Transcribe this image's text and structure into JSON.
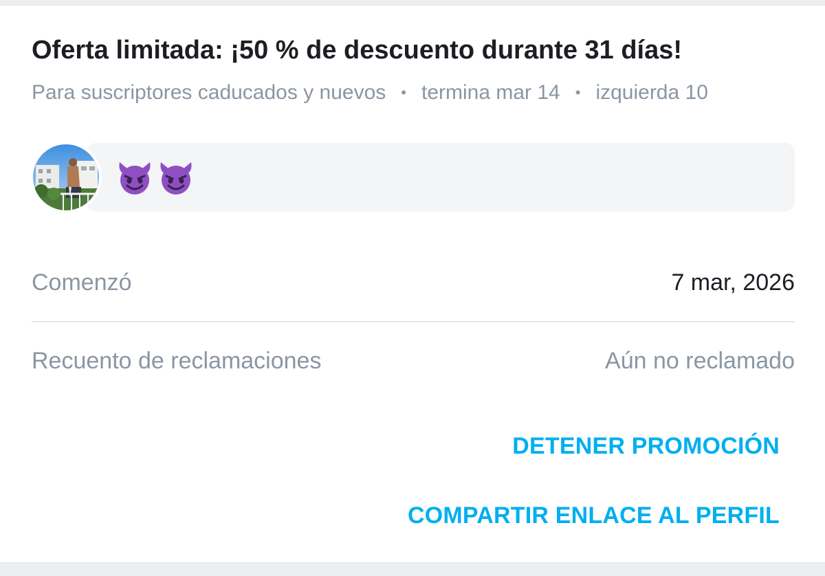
{
  "promo": {
    "title": "Oferta limitada: ¡50 % de descuento durante 31 días!",
    "audience": "Para suscriptores caducados y nuevos",
    "ends": "termina mar 14",
    "remaining": "izquierda 10",
    "separator": "•",
    "discount_percent": 50,
    "duration_days": 31
  },
  "message": {
    "emojis": [
      "devil-emoji",
      "devil-emoji"
    ],
    "text": "😈😈"
  },
  "details": {
    "started_label": "Comenzó",
    "started_value": "7 mar, 2026",
    "claims_label": "Recuento de reclamaciones",
    "claims_value": "Aún no reclamado"
  },
  "actions": {
    "stop_label": "DETENER PROMOCIÓN",
    "share_label": "COMPARTIR ENLACE AL PERFIL"
  },
  "colors": {
    "accent": "#00aff0",
    "title": "#1c1e24",
    "muted": "#8a96a3",
    "bubble": "#f4f5f7",
    "devil_purple": "#8e4fc3"
  },
  "icons": {
    "avatar": "profile-avatar-photo",
    "separator": "dot-separator"
  }
}
